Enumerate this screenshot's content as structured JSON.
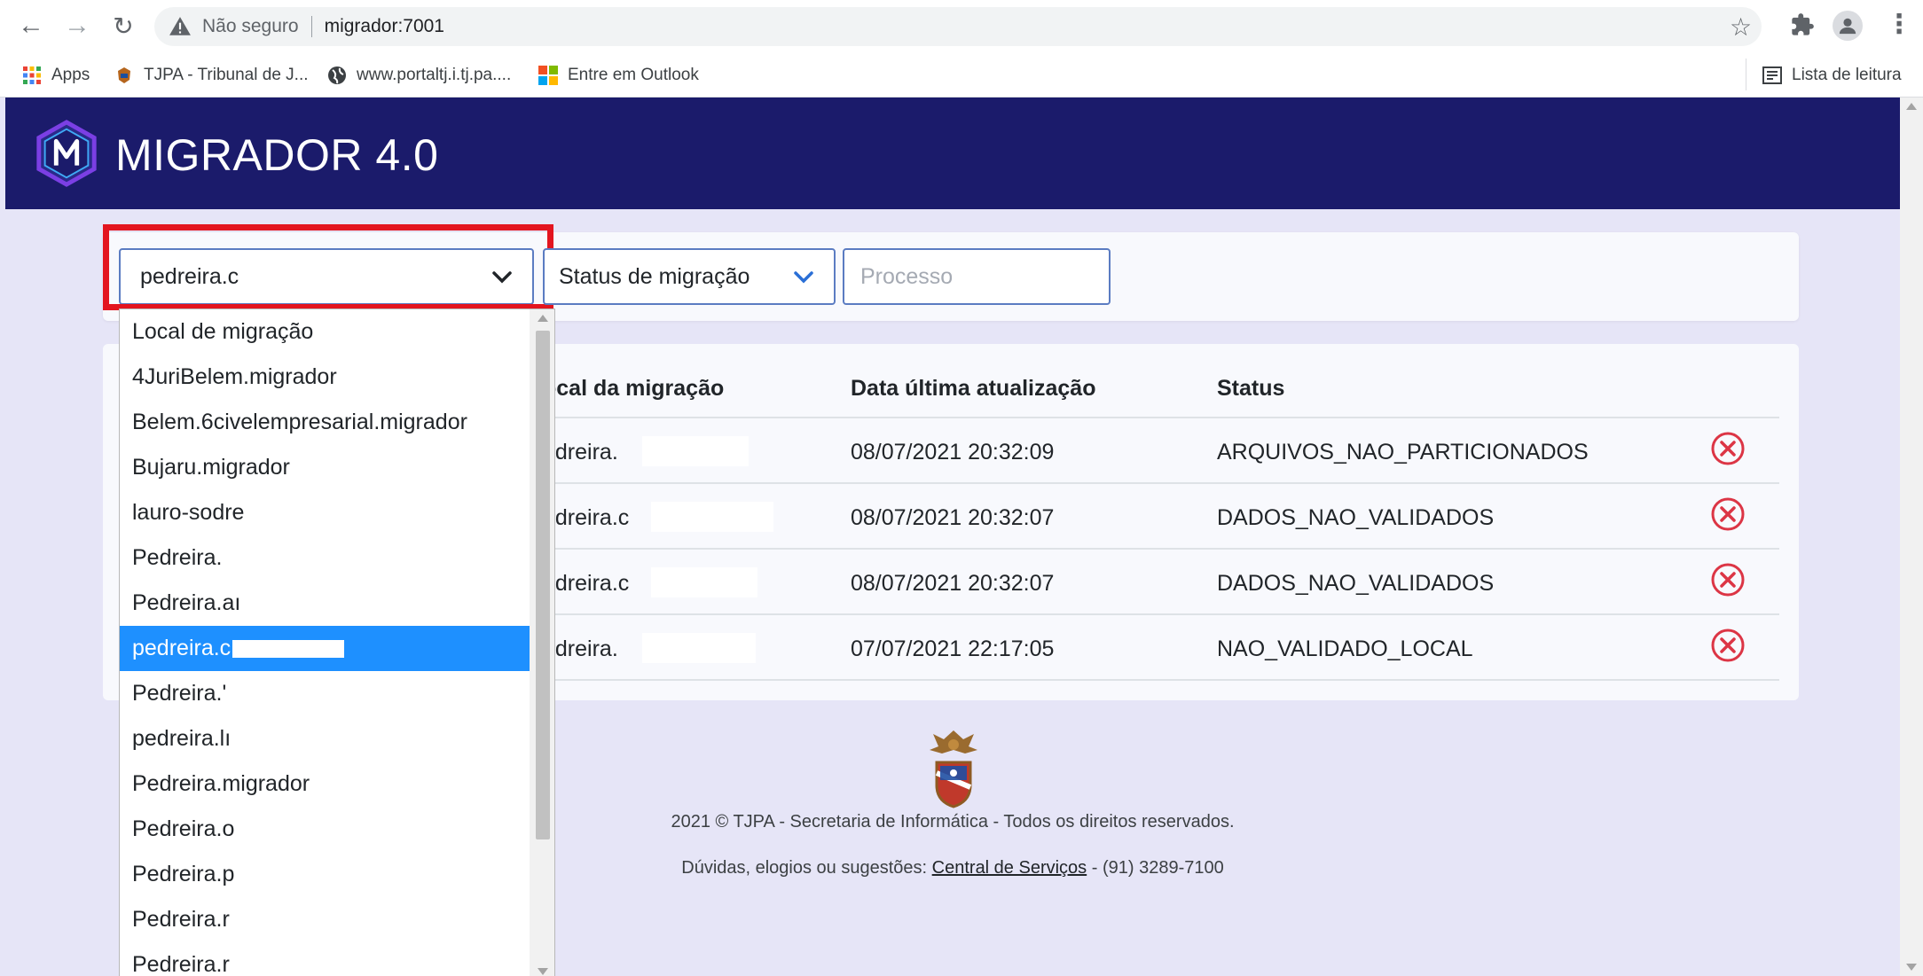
{
  "browser": {
    "insecure_label": "Não seguro",
    "url": "migrador:7001",
    "bookmarks": [
      {
        "label": "Apps",
        "icon": "apps-grid-icon"
      },
      {
        "label": "TJPA - Tribunal de J...",
        "icon": "tjpa-icon"
      },
      {
        "label": "www.portaltj.i.tj.pa....",
        "icon": "globe-icon"
      },
      {
        "label": "Entre em Outlook",
        "icon": "microsoft-icon"
      }
    ],
    "reading_list": "Lista de leitura"
  },
  "app": {
    "title": "MIGRADOR 4.0",
    "brand_color": "#1b1b6b"
  },
  "filters": {
    "local_value": "pedreira.c",
    "status_placeholder": "Status de migração",
    "processo_placeholder": "Processo"
  },
  "dropdown": {
    "items": [
      "Local de migração",
      "4JuriBelem.migrador",
      "Belem.6civelempresarial.migrador",
      "Bujaru.migrador",
      "lauro-sodre",
      "Pedreira.",
      "Pedreira.aı",
      "pedreira.c",
      "Pedreira.'",
      "pedreira.lı",
      "Pedreira.migrador",
      "Pedreira.o",
      "Pedreira.p",
      "Pedreira.r",
      "Pedreira.r"
    ],
    "selected_index": 7,
    "selected_color": "#1e90ff"
  },
  "table": {
    "headers": [
      "ocal da migração",
      "Data última atualização",
      "Status"
    ],
    "rows": [
      {
        "local": "edreira.",
        "date": "08/07/2021 20:32:09",
        "status": "ARQUIVOS_NAO_PARTICIONADOS"
      },
      {
        "local": "edreira.c",
        "date": "08/07/2021 20:32:07",
        "status": "DADOS_NAO_VALIDADOS"
      },
      {
        "local": "edreira.c",
        "date": "08/07/2021 20:32:07",
        "status": "DADOS_NAO_VALIDADOS"
      },
      {
        "local": "edreira.",
        "date": "07/07/2021 22:17:05",
        "status": "NAO_VALIDADO_LOCAL"
      }
    ],
    "delete_icon_color": "#dc3545"
  },
  "footer": {
    "copyright": "2021 © TJPA - Secretaria de Informática - Todos os direitos reservados.",
    "contact_prefix": "Dúvidas, elogios ou sugestões: ",
    "contact_link": "Central de Serviços",
    "contact_suffix": " - (91) 3289-7100"
  }
}
